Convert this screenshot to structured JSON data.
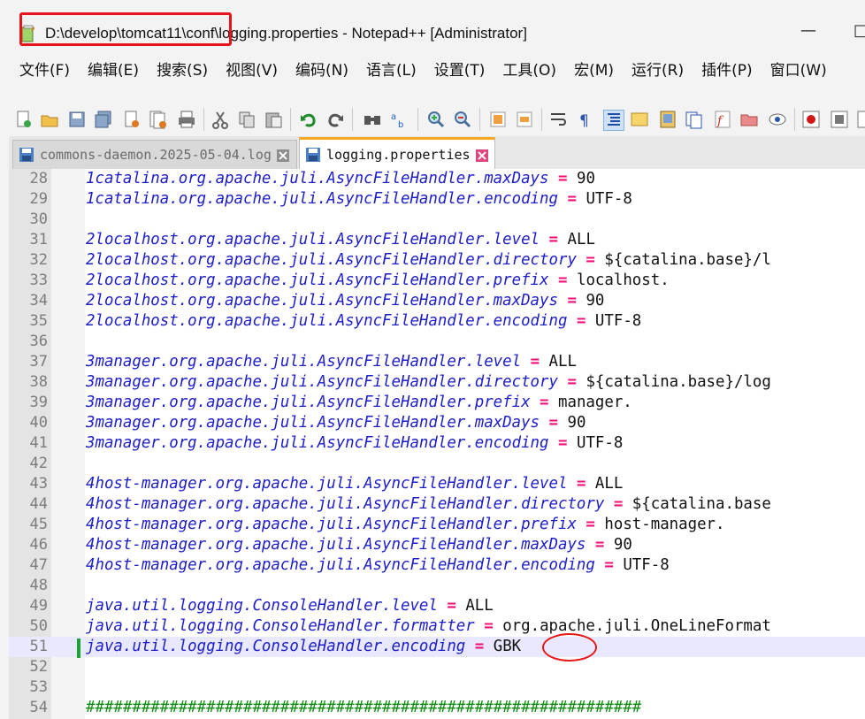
{
  "window": {
    "title": "D:\\develop\\tomcat11\\conf\\logging.properties - Notepad++ [Administrator]",
    "minimize": "—",
    "maximize": "□"
  },
  "menu": [
    "文件(F)",
    "编辑(E)",
    "搜索(S)",
    "视图(V)",
    "编码(N)",
    "语言(L)",
    "设置(T)",
    "工具(O)",
    "宏(M)",
    "运行(R)",
    "插件(P)",
    "窗口(W)"
  ],
  "tabs": [
    {
      "label": "commons-daemon.2025-05-04.log",
      "active": false
    },
    {
      "label": "logging.properties",
      "active": true
    }
  ],
  "editor": {
    "current_line": "51",
    "lines": [
      {
        "n": "28",
        "key": "1catalina.org.apache.juli.AsyncFileHandler.maxDays",
        "op": "=",
        "val": "90"
      },
      {
        "n": "29",
        "key": "1catalina.org.apache.juli.AsyncFileHandler.encoding",
        "op": "=",
        "val": "UTF-8"
      },
      {
        "n": "30",
        "key": "",
        "op": "",
        "val": ""
      },
      {
        "n": "31",
        "key": "2localhost.org.apache.juli.AsyncFileHandler.level",
        "op": "=",
        "val": "ALL"
      },
      {
        "n": "32",
        "key": "2localhost.org.apache.juli.AsyncFileHandler.directory",
        "op": "=",
        "val": "${catalina.base}/l"
      },
      {
        "n": "33",
        "key": "2localhost.org.apache.juli.AsyncFileHandler.prefix",
        "op": "=",
        "val": "localhost."
      },
      {
        "n": "34",
        "key": "2localhost.org.apache.juli.AsyncFileHandler.maxDays",
        "op": "=",
        "val": "90"
      },
      {
        "n": "35",
        "key": "2localhost.org.apache.juli.AsyncFileHandler.encoding",
        "op": "=",
        "val": "UTF-8"
      },
      {
        "n": "36",
        "key": "",
        "op": "",
        "val": ""
      },
      {
        "n": "37",
        "key": "3manager.org.apache.juli.AsyncFileHandler.level",
        "op": "=",
        "val": "ALL"
      },
      {
        "n": "38",
        "key": "3manager.org.apache.juli.AsyncFileHandler.directory",
        "op": "=",
        "val": "${catalina.base}/log"
      },
      {
        "n": "39",
        "key": "3manager.org.apache.juli.AsyncFileHandler.prefix",
        "op": "=",
        "val": "manager."
      },
      {
        "n": "40",
        "key": "3manager.org.apache.juli.AsyncFileHandler.maxDays",
        "op": "=",
        "val": "90"
      },
      {
        "n": "41",
        "key": "3manager.org.apache.juli.AsyncFileHandler.encoding",
        "op": "=",
        "val": "UTF-8"
      },
      {
        "n": "42",
        "key": "",
        "op": "",
        "val": ""
      },
      {
        "n": "43",
        "key": "4host-manager.org.apache.juli.AsyncFileHandler.level",
        "op": "=",
        "val": "ALL"
      },
      {
        "n": "44",
        "key": "4host-manager.org.apache.juli.AsyncFileHandler.directory",
        "op": "=",
        "val": "${catalina.base"
      },
      {
        "n": "45",
        "key": "4host-manager.org.apache.juli.AsyncFileHandler.prefix",
        "op": "=",
        "val": "host-manager."
      },
      {
        "n": "46",
        "key": "4host-manager.org.apache.juli.AsyncFileHandler.maxDays",
        "op": "=",
        "val": "90"
      },
      {
        "n": "47",
        "key": "4host-manager.org.apache.juli.AsyncFileHandler.encoding",
        "op": "=",
        "val": "UTF-8"
      },
      {
        "n": "48",
        "key": "",
        "op": "",
        "val": ""
      },
      {
        "n": "49",
        "key": "java.util.logging.ConsoleHandler.level",
        "op": "=",
        "val": "ALL"
      },
      {
        "n": "50",
        "key": "java.util.logging.ConsoleHandler.formatter",
        "op": "=",
        "val": "org.apache.juli.OneLineFormat"
      },
      {
        "n": "51",
        "key": "java.util.logging.ConsoleHandler.encoding",
        "op": "=",
        "val": "GBK"
      },
      {
        "n": "52",
        "key": "",
        "op": "",
        "val": ""
      },
      {
        "n": "53",
        "key": "",
        "op": "",
        "val": ""
      },
      {
        "n": "54",
        "key": "",
        "op": "",
        "val": "",
        "comment": "############################################################"
      }
    ]
  },
  "colors": {
    "key": "#1d1dcb",
    "operator": "#f0117a",
    "comment": "#0d8a10",
    "annotation": "#e51717"
  }
}
